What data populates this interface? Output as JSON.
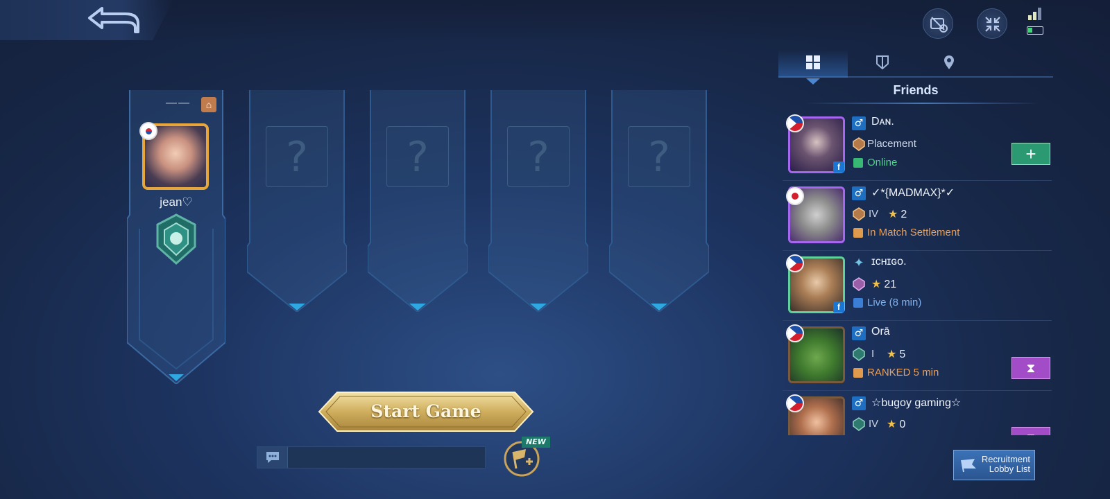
{
  "header": {
    "back_icon": "back-arrow-icon",
    "icons": [
      "screen-record-icon",
      "collapse-icon"
    ],
    "battery_color": "#42d27a"
  },
  "team": {
    "owner": {
      "top_label": "——",
      "home_icon": "⌂",
      "name": "jean♡",
      "frame_color": "#e6a63a"
    },
    "empty_slot_symbol": "?"
  },
  "start_button": {
    "label": "Start Game"
  },
  "lobby": {
    "new_tag": "NEW"
  },
  "panel": {
    "tabs": [
      {
        "icon": "grid-icon",
        "active": true
      },
      {
        "icon": "shield-icon",
        "active": false
      },
      {
        "icon": "location-pin-icon",
        "active": false
      }
    ],
    "title": "Friends"
  },
  "friends": [
    {
      "name": "Dᴀɴ.",
      "gender": "♂",
      "rank": "Placement",
      "stars": "",
      "status": "Online",
      "status_color": "#4fd28a",
      "flag": "ph",
      "action": "+",
      "fb": "f"
    },
    {
      "name": "✓*{MADMAX}*✓",
      "gender": "♂",
      "rank": "IV",
      "stars": "2",
      "status": "In Match Settlement",
      "status_color": "#e6a05c",
      "flag": "jp",
      "action": "",
      "fb": ""
    },
    {
      "name": "ɪᴄʜɪɢᴏ.",
      "gender": "✦",
      "rank": "",
      "stars": "21",
      "status": "Live (8 min)",
      "status_color": "#7fb1ee",
      "flag": "ph",
      "action": "",
      "fb": "f"
    },
    {
      "name": "Orā",
      "gender": "♂",
      "rank": "I",
      "stars": "5",
      "status": "RANKED 5 min",
      "status_color": "#e6a05c",
      "flag": "ph",
      "action": "⧗",
      "fb": ""
    },
    {
      "name": "☆bugoy gaming☆",
      "gender": "♂",
      "rank": "IV",
      "stars": "0",
      "status": "",
      "status_color": "#e6a05c",
      "flag": "ph",
      "action": "⧗",
      "fb": ""
    }
  ],
  "recruit": {
    "label": "Recruitment\nLobby List"
  }
}
